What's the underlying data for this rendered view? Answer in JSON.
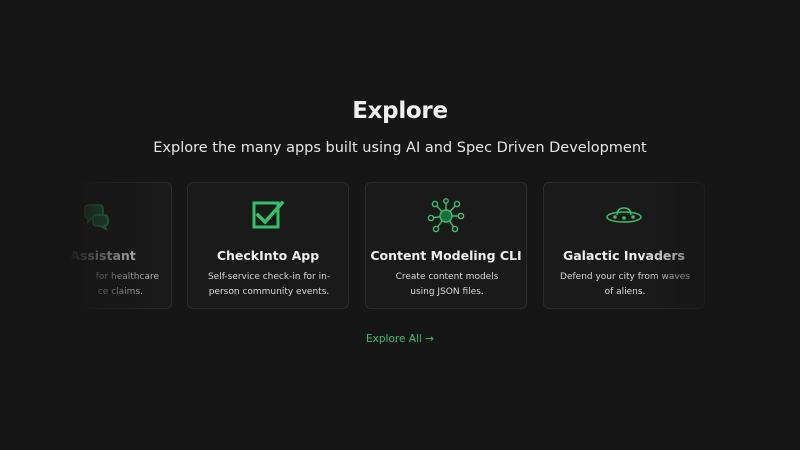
{
  "section": {
    "title": "Explore",
    "subtitle": "Explore the many apps built using AI and Spec Driven Development"
  },
  "cards": [
    {
      "title": "Assistant",
      "description": "for healthcare ce claims.",
      "description_line1": "for healthcare",
      "description_line2": "ce claims.",
      "icon": "chat-bubbles-icon"
    },
    {
      "title": "CheckInto App",
      "description_line1": "Self-service check-in for in-",
      "description_line2": "person community events.",
      "icon": "checkbox-icon"
    },
    {
      "title": "Content Modeling CLI",
      "description_line1": "Create content models",
      "description_line2": "using JSON files.",
      "icon": "network-nodes-icon"
    },
    {
      "title": "Galactic Invaders",
      "description_line1": "Defend your city from waves",
      "description_line2": "of aliens.",
      "icon": "ufo-icon"
    }
  ],
  "explore_all": {
    "label": "Explore All →"
  },
  "colors": {
    "background": "#161616",
    "accent": "#2fc46a",
    "card_border": "#2c2c2c"
  }
}
